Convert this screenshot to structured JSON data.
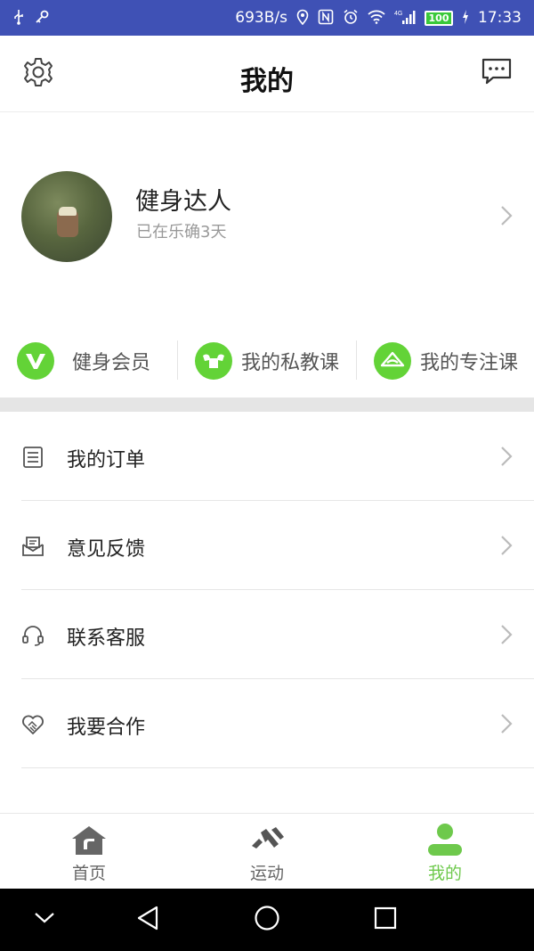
{
  "status_bar": {
    "net_speed": "693B/s",
    "signal_label": "4G",
    "battery": "100",
    "time": "17:33",
    "icons": [
      "usb-icon",
      "key-icon",
      "location-icon",
      "nfc-icon",
      "alarm-icon",
      "wifi-icon",
      "signal-icon",
      "battery-icon",
      "charging-icon"
    ]
  },
  "header": {
    "title": "我的",
    "left_icon": "settings-icon",
    "right_icon": "message-icon"
  },
  "profile": {
    "name": "健身达人",
    "days_text": "已在乐确3天"
  },
  "quick_actions": [
    {
      "label": "健身会员",
      "icon": "vip-v-icon"
    },
    {
      "label": "我的私教课",
      "icon": "muscle-icon"
    },
    {
      "label": "我的专注课",
      "icon": "focus-icon"
    }
  ],
  "menu": [
    {
      "label": "我的订单",
      "icon": "order-list-icon"
    },
    {
      "label": "意见反馈",
      "icon": "feedback-icon"
    },
    {
      "label": "联系客服",
      "icon": "headset-icon"
    },
    {
      "label": "我要合作",
      "icon": "handshake-icon"
    }
  ],
  "tabs": [
    {
      "label": "首页",
      "icon": "home-icon",
      "active": false
    },
    {
      "label": "运动",
      "icon": "running-icon",
      "active": false
    },
    {
      "label": "我的",
      "icon": "user-icon",
      "active": true
    }
  ],
  "colors": {
    "status_bar": "#3f51b5",
    "accent_green": "#63d337",
    "active_tab": "#6ec94c"
  }
}
